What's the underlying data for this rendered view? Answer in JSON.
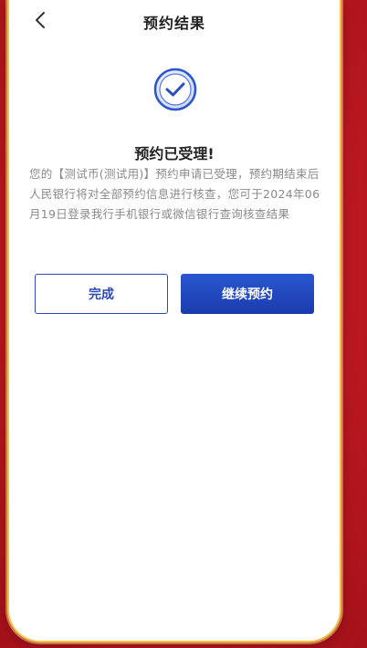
{
  "header": {
    "title": "预约结果",
    "back_icon": "chevron-left-icon"
  },
  "result": {
    "icon": "check-circle-icon",
    "status_title": "预约已受理!",
    "description": "您的【测试币(测试用)】预约申请已受理，预约期结束后人民银行将对全部预约信息进行核查，您可于2024年06月19日登录我行手机银行或微信银行查询核查结果"
  },
  "actions": {
    "done_label": "完成",
    "continue_label": "继续预约"
  },
  "colors": {
    "primary": "#1b3cae",
    "background_red": "#c41a22",
    "gold": "#f2c14a"
  }
}
